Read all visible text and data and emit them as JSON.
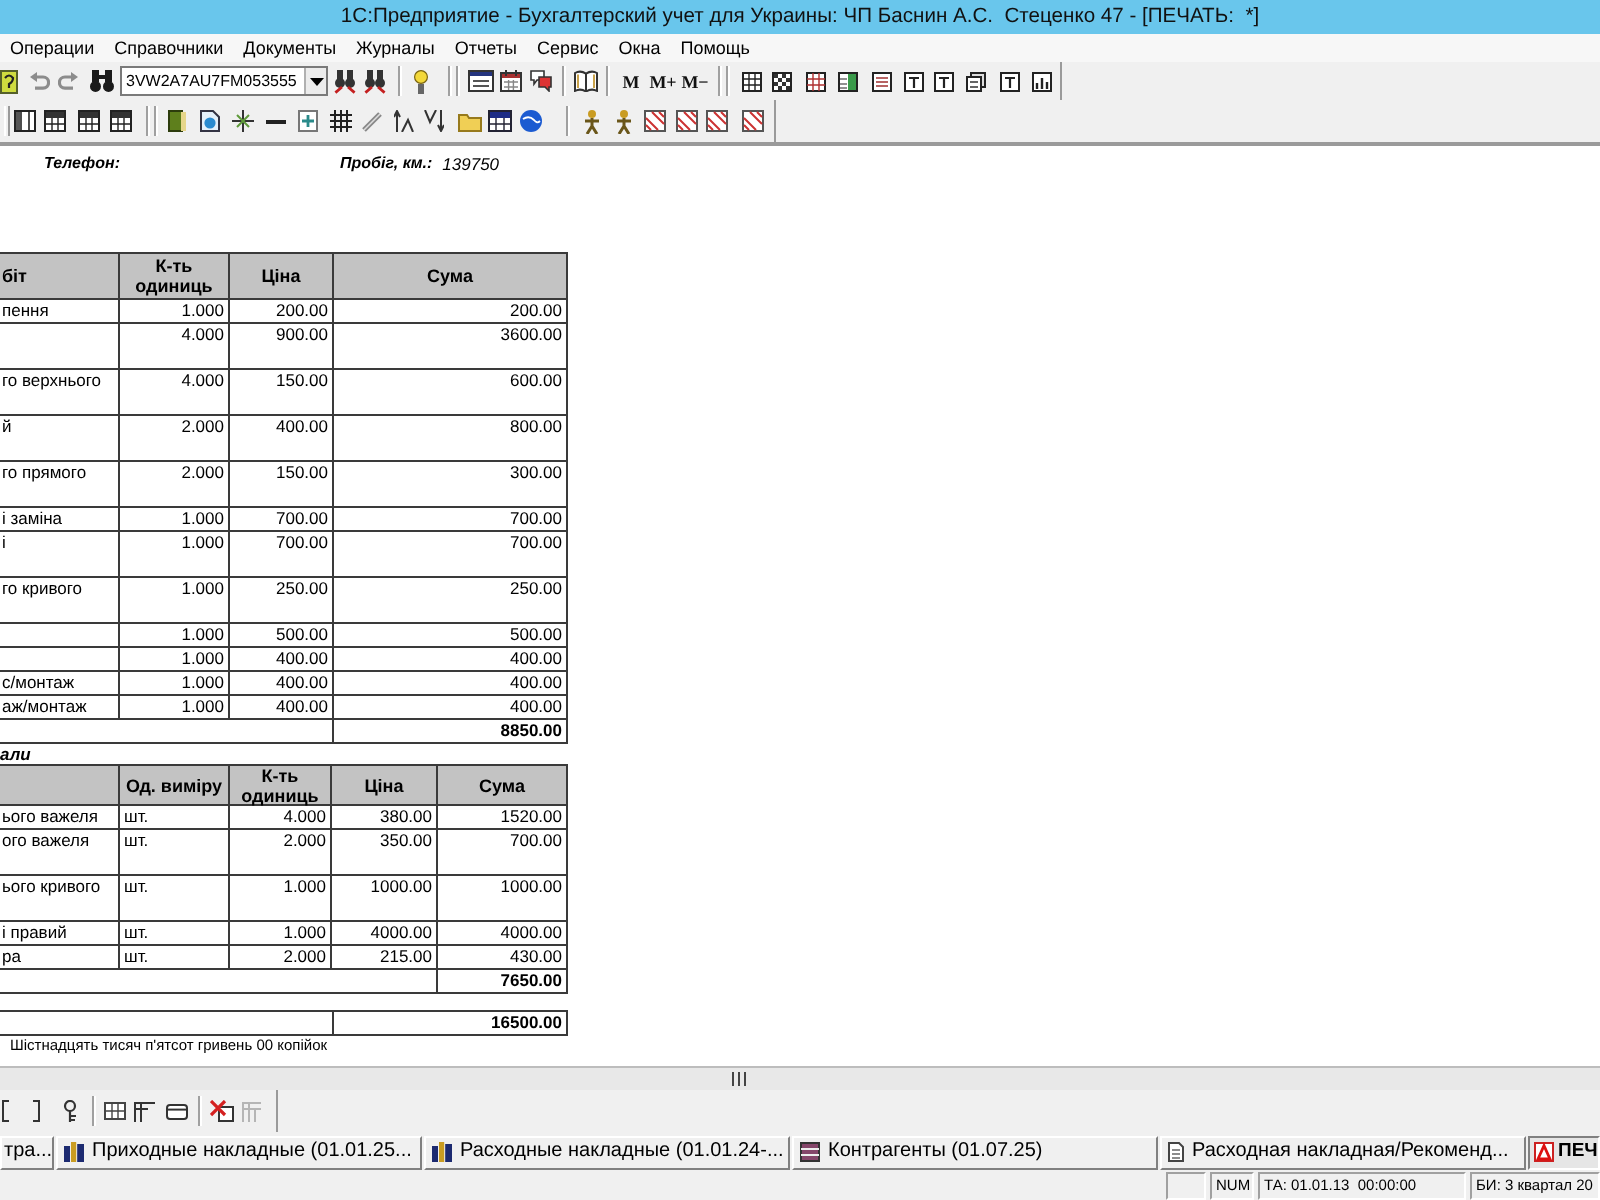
{
  "window": {
    "title": "1С:Предприятие - Бухгалтерский учет для Украины: ЧП Баснин А.С.  Стеценко 47 - [ПЕЧАТЬ:  *]"
  },
  "menu": {
    "items": [
      "Операции",
      "Справочники",
      "Документы",
      "Журналы",
      "Отчеты",
      "Сервис",
      "Окна",
      "Помощь"
    ]
  },
  "toolbar": {
    "search_combo": {
      "value": "3VW2A7AU7FM053555"
    },
    "memory_buttons": [
      "M",
      "M+",
      "M−"
    ]
  },
  "document": {
    "fields": [
      {
        "label": "Телефон:"
      },
      {
        "label": "Пробіг, км.:",
        "value": "139750"
      }
    ],
    "tables": [
      {
        "columns": {
          "name": "біт",
          "quantity": "К-ть одиниць",
          "price": "Ціна",
          "sum": "Сума"
        },
        "rows": [
          {
            "name": "пення",
            "quantity": "1.000",
            "price": "200.00",
            "sum": "200.00",
            "wrapped": false
          },
          {
            "quantity": "4.000",
            "price": "900.00",
            "sum": "3600.00",
            "wrapped": true
          },
          {
            "name": "го верхнього",
            "quantity": "4.000",
            "price": "150.00",
            "sum": "600.00",
            "wrapped": true
          },
          {
            "name": "й",
            "quantity": "2.000",
            "price": "400.00",
            "sum": "800.00",
            "wrapped": true
          },
          {
            "name": "го прямого",
            "quantity": "2.000",
            "price": "150.00",
            "sum": "300.00",
            "wrapped": true
          },
          {
            "name": "і заміна",
            "quantity": "1.000",
            "price": "700.00",
            "sum": "700.00",
            "wrapped": false
          },
          {
            "name": "і",
            "quantity": "1.000",
            "price": "700.00",
            "sum": "700.00",
            "wrapped": true
          },
          {
            "name": "го кривого",
            "quantity": "1.000",
            "price": "250.00",
            "sum": "250.00",
            "wrapped": true
          },
          {
            "quantity": "1.000",
            "price": "500.00",
            "sum": "500.00",
            "wrapped": false
          },
          {
            "quantity": "1.000",
            "price": "400.00",
            "sum": "400.00",
            "wrapped": false
          },
          {
            "name": "с/монтаж",
            "quantity": "1.000",
            "price": "400.00",
            "sum": "400.00",
            "wrapped": false
          },
          {
            "name": "аж/монтаж",
            "quantity": "1.000",
            "price": "400.00",
            "sum": "400.00",
            "wrapped": false
          }
        ],
        "total": "8850.00"
      },
      {
        "heading": "али",
        "columns": {
          "unit": "Од. виміру",
          "quantity": "К-ть одиниць",
          "price": "Ціна",
          "sum": "Сума"
        },
        "rows": [
          {
            "name": "ього важеля",
            "unit": "шт.",
            "quantity": "4.000",
            "price": "380.00",
            "sum": "1520.00",
            "wrapped": false
          },
          {
            "name": "ого важеля",
            "unit": "шт.",
            "quantity": "2.000",
            "price": "350.00",
            "sum": "700.00",
            "wrapped": true
          },
          {
            "name": "ього кривого",
            "unit": "шт.",
            "quantity": "1.000",
            "price": "1000.00",
            "sum": "1000.00",
            "wrapped": true
          },
          {
            "name": "і правий",
            "unit": "шт.",
            "quantity": "1.000",
            "price": "4000.00",
            "sum": "4000.00",
            "wrapped": false
          },
          {
            "name": "ра",
            "unit": "шт.",
            "quantity": "2.000",
            "price": "215.00",
            "sum": "430.00",
            "wrapped": false
          }
        ],
        "total": "7650.00"
      }
    ],
    "grand_total": "16500.00",
    "amount_in_words": "Шістнадцять тисяч п'ятсот гривень 00 копійок"
  },
  "taskbar": {
    "items": [
      {
        "label": "тра...",
        "selected": false
      },
      {
        "kind": "journal",
        "label": "Приходные накладные (01.01.25...",
        "selected": false
      },
      {
        "kind": "journal",
        "label": "Расходные накладные (01.01.24-...",
        "selected": false
      },
      {
        "kind": "directory",
        "label": "Контрагенты (01.07.25)",
        "selected": false
      },
      {
        "kind": "document",
        "label": "Расходная накладная/Рекоменд...",
        "selected": false
      },
      {
        "kind": "print",
        "label": "ПЕЧ",
        "selected": true
      }
    ]
  },
  "status_bar": {
    "fields": [
      "NUM",
      "ТА: 01.01.13  00:00:00",
      "БИ: 3 квартал 20"
    ]
  }
}
